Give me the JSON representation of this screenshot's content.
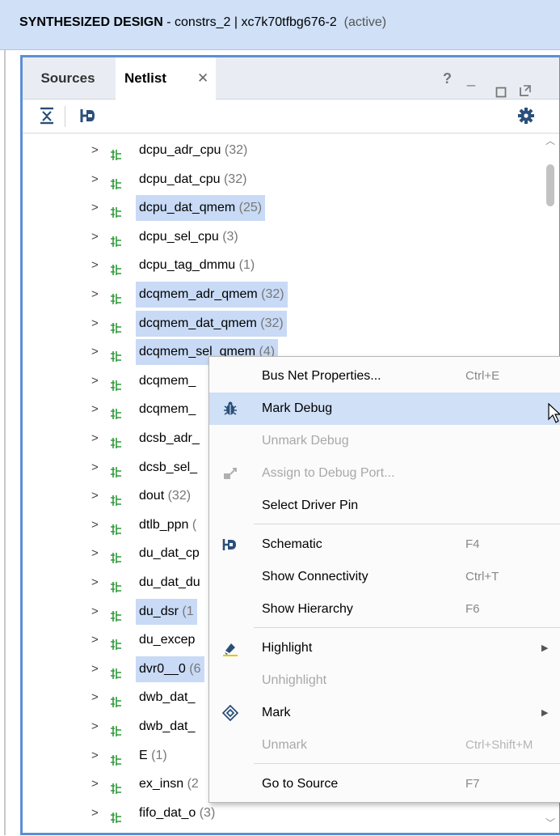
{
  "window": {
    "title_bold": "SYNTHESIZED DESIGN",
    "title_rest": " - constrs_2 | xc7k70tfbg676-2",
    "title_active": "(active)"
  },
  "tabs": [
    {
      "label": "Sources"
    },
    {
      "label": "Netlist"
    }
  ],
  "panel_controls": {
    "help": "?",
    "minimize": "_"
  },
  "nets": [
    {
      "name": "dcpu_adr_cpu",
      "count": " (32)",
      "selected": false
    },
    {
      "name": "dcpu_dat_cpu",
      "count": " (32)",
      "selected": false
    },
    {
      "name": "dcpu_dat_qmem",
      "count": " (25)",
      "selected": true
    },
    {
      "name": "dcpu_sel_cpu",
      "count": " (3)",
      "selected": false
    },
    {
      "name": "dcpu_tag_dmmu",
      "count": " (1)",
      "selected": false
    },
    {
      "name": "dcqmem_adr_qmem",
      "count": " (32)",
      "selected": true
    },
    {
      "name": "dcqmem_dat_qmem",
      "count": " (32)",
      "selected": true
    },
    {
      "name": "dcqmem_sel_qmem",
      "count": " (4)",
      "selected": true
    },
    {
      "name": "dcqmem_",
      "count": "",
      "selected": false
    },
    {
      "name": "dcqmem_",
      "count": "",
      "selected": false
    },
    {
      "name": "dcsb_adr_",
      "count": "",
      "selected": false
    },
    {
      "name": "dcsb_sel_",
      "count": "",
      "selected": false
    },
    {
      "name": "dout",
      "count": " (32)",
      "selected": false
    },
    {
      "name": "dtlb_ppn",
      "count": " (",
      "selected": false
    },
    {
      "name": "du_dat_cp",
      "count": "",
      "selected": false
    },
    {
      "name": "du_dat_du",
      "count": "",
      "selected": false
    },
    {
      "name": "du_dsr",
      "count": " (1",
      "selected": true
    },
    {
      "name": "du_excep",
      "count": "",
      "selected": false
    },
    {
      "name": "dvr0__0",
      "count": " (6",
      "selected": true
    },
    {
      "name": "dwb_dat_",
      "count": "",
      "selected": false
    },
    {
      "name": "dwb_dat_",
      "count": "",
      "selected": false
    },
    {
      "name": "E",
      "count": " (1)",
      "selected": false
    },
    {
      "name": "ex_insn",
      "count": " (2",
      "selected": false
    },
    {
      "name": "fifo_dat_o",
      "count": " (3)",
      "selected": false
    }
  ],
  "context_menu": {
    "items": [
      {
        "label": "Bus Net Properties...",
        "shortcut": "Ctrl+E",
        "icon": "none",
        "disabled": false,
        "submenu": false,
        "highlighted": false
      },
      {
        "label": "Mark Debug",
        "shortcut": "",
        "icon": "bug-icon",
        "disabled": false,
        "submenu": false,
        "highlighted": true
      },
      {
        "label": "Unmark Debug",
        "shortcut": "",
        "icon": "none",
        "disabled": true,
        "submenu": false,
        "highlighted": false
      },
      {
        "label": "Assign to Debug Port...",
        "shortcut": "",
        "icon": "debug-port-icon",
        "disabled": true,
        "submenu": false,
        "highlighted": false
      },
      {
        "label": "Select Driver Pin",
        "shortcut": "",
        "icon": "none",
        "disabled": false,
        "submenu": false,
        "highlighted": false
      },
      {
        "label": "Schematic",
        "shortcut": "F4",
        "icon": "schematic-icon",
        "disabled": false,
        "submenu": false,
        "highlighted": false
      },
      {
        "label": "Show Connectivity",
        "shortcut": "Ctrl+T",
        "icon": "none",
        "disabled": false,
        "submenu": false,
        "highlighted": false
      },
      {
        "label": "Show Hierarchy",
        "shortcut": "F6",
        "icon": "none",
        "disabled": false,
        "submenu": false,
        "highlighted": false
      },
      {
        "label": "Highlight",
        "shortcut": "",
        "icon": "highlight-icon",
        "disabled": false,
        "submenu": true,
        "highlighted": false
      },
      {
        "label": "Unhighlight",
        "shortcut": "",
        "icon": "none",
        "disabled": true,
        "submenu": false,
        "highlighted": false
      },
      {
        "label": "Mark",
        "shortcut": "",
        "icon": "mark-icon",
        "disabled": false,
        "submenu": true,
        "highlighted": false
      },
      {
        "label": "Unmark",
        "shortcut": "Ctrl+Shift+M",
        "icon": "none",
        "disabled": true,
        "submenu": false,
        "highlighted": false
      },
      {
        "label": "Go to Source",
        "shortcut": "F7",
        "icon": "none",
        "disabled": false,
        "submenu": false,
        "highlighted": false
      }
    ]
  },
  "colors": {
    "accent": "#5b8fd6",
    "selection": "#c8daf5",
    "bus_icon": "#2e9a3a"
  }
}
